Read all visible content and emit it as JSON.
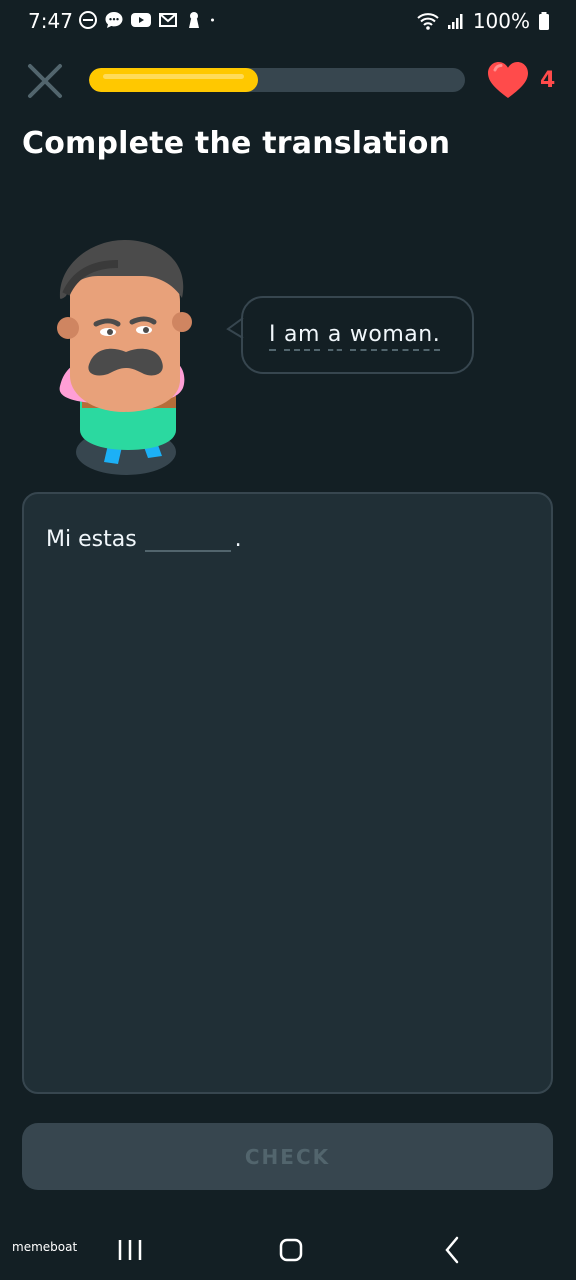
{
  "status_bar": {
    "time": "7:47",
    "battery": "100%",
    "icons_left": [
      "do-not-disturb-icon",
      "chat-icon",
      "youtube-icon",
      "gmail-icon",
      "keyhole-icon",
      "dot-icon"
    ],
    "icons_right": [
      "wifi-icon",
      "signal-icon",
      "battery-icon"
    ]
  },
  "header": {
    "progress": 0.45,
    "progress_color": "#ffc800",
    "hearts": "4",
    "heart_color": "#ff4b4b"
  },
  "title": "Complete the translation",
  "prompt": {
    "words": [
      "I",
      "am",
      "a",
      "woman."
    ]
  },
  "answer": {
    "prefix": "Mi estas",
    "suffix": "."
  },
  "check_button": "CHECK",
  "watermark": "memeboat"
}
